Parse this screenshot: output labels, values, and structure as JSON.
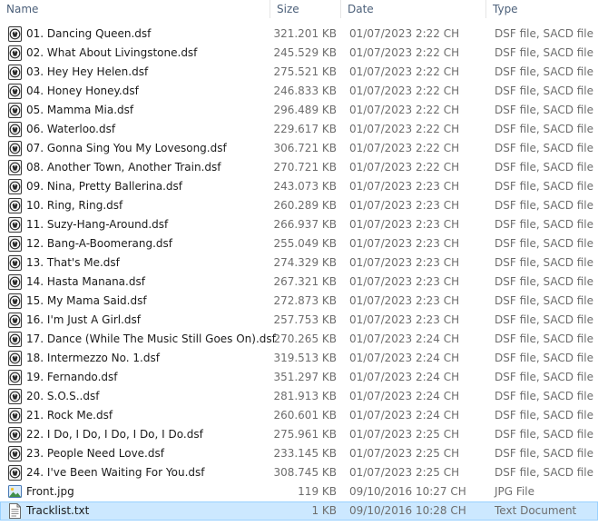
{
  "columns": {
    "name": "Name",
    "size": "Size",
    "date": "Date",
    "type": "Type"
  },
  "files": [
    {
      "name": "01. Dancing Queen.dsf",
      "size": "321.201 KB",
      "date": "01/07/2023 2:22 CH",
      "type": "DSF file, SACD file",
      "icon": "dsf-file-icon"
    },
    {
      "name": "02. What About Livingstone.dsf",
      "size": "245.529 KB",
      "date": "01/07/2023 2:22 CH",
      "type": "DSF file, SACD file",
      "icon": "dsf-file-icon"
    },
    {
      "name": "03. Hey Hey Helen.dsf",
      "size": "275.521 KB",
      "date": "01/07/2023 2:22 CH",
      "type": "DSF file, SACD file",
      "icon": "dsf-file-icon"
    },
    {
      "name": "04. Honey Honey.dsf",
      "size": "246.833 KB",
      "date": "01/07/2023 2:22 CH",
      "type": "DSF file, SACD file",
      "icon": "dsf-file-icon"
    },
    {
      "name": "05. Mamma Mia.dsf",
      "size": "296.489 KB",
      "date": "01/07/2023 2:22 CH",
      "type": "DSF file, SACD file",
      "icon": "dsf-file-icon"
    },
    {
      "name": "06. Waterloo.dsf",
      "size": "229.617 KB",
      "date": "01/07/2023 2:22 CH",
      "type": "DSF file, SACD file",
      "icon": "dsf-file-icon"
    },
    {
      "name": "07. Gonna Sing You My Lovesong.dsf",
      "size": "306.721 KB",
      "date": "01/07/2023 2:22 CH",
      "type": "DSF file, SACD file",
      "icon": "dsf-file-icon"
    },
    {
      "name": "08. Another Town, Another Train.dsf",
      "size": "270.721 KB",
      "date": "01/07/2023 2:22 CH",
      "type": "DSF file, SACD file",
      "icon": "dsf-file-icon"
    },
    {
      "name": "09. Nina, Pretty Ballerina.dsf",
      "size": "243.073 KB",
      "date": "01/07/2023 2:23 CH",
      "type": "DSF file, SACD file",
      "icon": "dsf-file-icon"
    },
    {
      "name": "10. Ring, Ring.dsf",
      "size": "260.289 KB",
      "date": "01/07/2023 2:23 CH",
      "type": "DSF file, SACD file",
      "icon": "dsf-file-icon"
    },
    {
      "name": "11. Suzy-Hang-Around.dsf",
      "size": "266.937 KB",
      "date": "01/07/2023 2:23 CH",
      "type": "DSF file, SACD file",
      "icon": "dsf-file-icon"
    },
    {
      "name": "12. Bang-A-Boomerang.dsf",
      "size": "255.049 KB",
      "date": "01/07/2023 2:23 CH",
      "type": "DSF file, SACD file",
      "icon": "dsf-file-icon"
    },
    {
      "name": "13. That's Me.dsf",
      "size": "274.329 KB",
      "date": "01/07/2023 2:23 CH",
      "type": "DSF file, SACD file",
      "icon": "dsf-file-icon"
    },
    {
      "name": "14. Hasta Manana.dsf",
      "size": "267.321 KB",
      "date": "01/07/2023 2:23 CH",
      "type": "DSF file, SACD file",
      "icon": "dsf-file-icon"
    },
    {
      "name": "15. My Mama Said.dsf",
      "size": "272.873 KB",
      "date": "01/07/2023 2:23 CH",
      "type": "DSF file, SACD file",
      "icon": "dsf-file-icon"
    },
    {
      "name": "16. I'm Just A Girl.dsf",
      "size": "257.753 KB",
      "date": "01/07/2023 2:23 CH",
      "type": "DSF file, SACD file",
      "icon": "dsf-file-icon"
    },
    {
      "name": "17. Dance (While The Music Still Goes On).dsf",
      "size": "270.265 KB",
      "date": "01/07/2023 2:24 CH",
      "type": "DSF file, SACD file",
      "icon": "dsf-file-icon"
    },
    {
      "name": "18. Intermezzo No. 1.dsf",
      "size": "319.513 KB",
      "date": "01/07/2023 2:24 CH",
      "type": "DSF file, SACD file",
      "icon": "dsf-file-icon"
    },
    {
      "name": "19. Fernando.dsf",
      "size": "351.297 KB",
      "date": "01/07/2023 2:24 CH",
      "type": "DSF file, SACD file",
      "icon": "dsf-file-icon"
    },
    {
      "name": "20. S.O.S..dsf",
      "size": "281.913 KB",
      "date": "01/07/2023 2:24 CH",
      "type": "DSF file, SACD file",
      "icon": "dsf-file-icon"
    },
    {
      "name": "21. Rock Me.dsf",
      "size": "260.601 KB",
      "date": "01/07/2023 2:24 CH",
      "type": "DSF file, SACD file",
      "icon": "dsf-file-icon"
    },
    {
      "name": "22. I Do, I Do, I Do, I Do, I Do.dsf",
      "size": "275.961 KB",
      "date": "01/07/2023 2:25 CH",
      "type": "DSF file, SACD file",
      "icon": "dsf-file-icon"
    },
    {
      "name": "23. People Need Love.dsf",
      "size": "233.145 KB",
      "date": "01/07/2023 2:25 CH",
      "type": "DSF file, SACD file",
      "icon": "dsf-file-icon"
    },
    {
      "name": "24. I've Been Waiting For You.dsf",
      "size": "308.745 KB",
      "date": "01/07/2023 2:25 CH",
      "type": "DSF file, SACD file",
      "icon": "dsf-file-icon"
    },
    {
      "name": "Front.jpg",
      "size": "119 KB",
      "date": "09/10/2016 10:27 CH",
      "type": "JPG File",
      "icon": "image-file-icon"
    },
    {
      "name": "Tracklist.txt",
      "size": "1 KB",
      "date": "09/10/2016 10:28 CH",
      "type": "Text Document",
      "icon": "text-file-icon",
      "selected": true
    }
  ]
}
